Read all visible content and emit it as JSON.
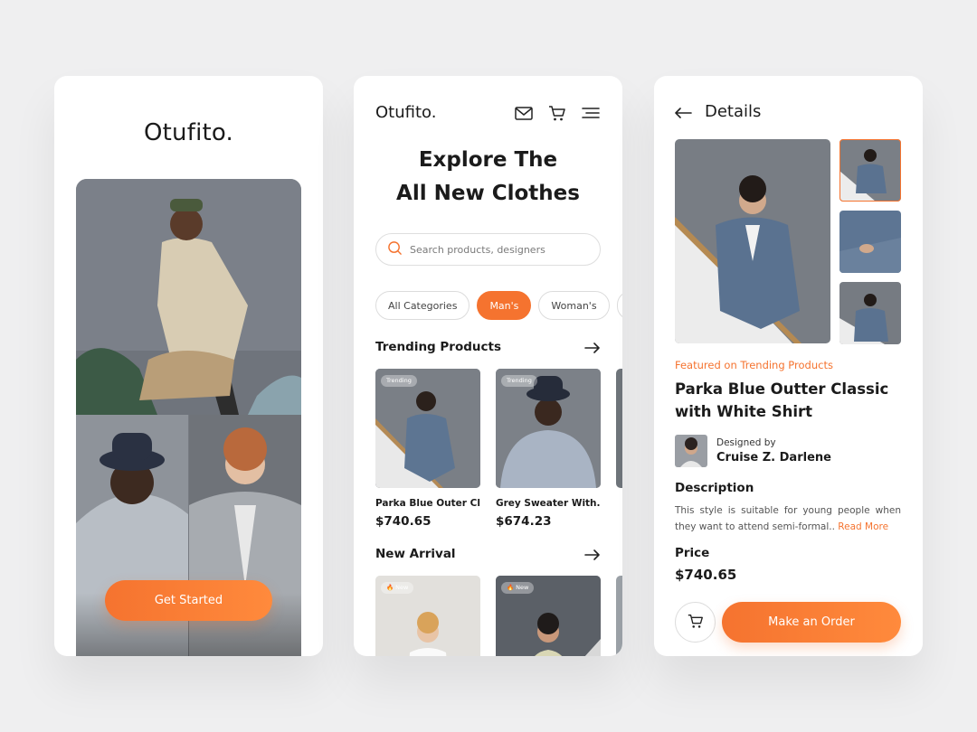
{
  "colors": {
    "accent": "#f5732f",
    "background": "#efeff0",
    "card": "#ffffff",
    "text": "#1b1b1b"
  },
  "screen1": {
    "logo": "Otufito.",
    "cta_label": "Get Started"
  },
  "screen2": {
    "logo": "Otufito.",
    "icons": [
      "mail-icon",
      "cart-icon",
      "menu-icon"
    ],
    "headline_line1": "Explore The",
    "headline_line2": "All New Clothes",
    "search": {
      "placeholder": "Search products, designers"
    },
    "categories": [
      {
        "label": "All Categories",
        "active": false
      },
      {
        "label": "Man's",
        "active": true
      },
      {
        "label": "Woman's",
        "active": false
      }
    ],
    "trending": {
      "title": "Trending Products",
      "items": [
        {
          "badge": "Trending",
          "name": "Parka Blue Outer Cl..",
          "price": "$740.65"
        },
        {
          "badge": "Trending",
          "name": "Grey Sweater With..",
          "price": "$674.23"
        }
      ]
    },
    "new_arrival": {
      "title": "New Arrival",
      "items": [
        {
          "badge": "New"
        },
        {
          "badge": "New"
        }
      ]
    }
  },
  "screen3": {
    "title": "Details",
    "featured_label": "Featured on Trending Products",
    "product_title": "Parka Blue Outter Classic with White Shirt",
    "designer_label": "Designed by",
    "designer_name": "Cruise Z. Darlene",
    "description_heading": "Description",
    "description_text": "This style is suitable for young people when they want to attend semi-formal.. ",
    "read_more": "Read More",
    "price_heading": "Price",
    "price": "$740.65",
    "order_label": "Make an Order"
  }
}
